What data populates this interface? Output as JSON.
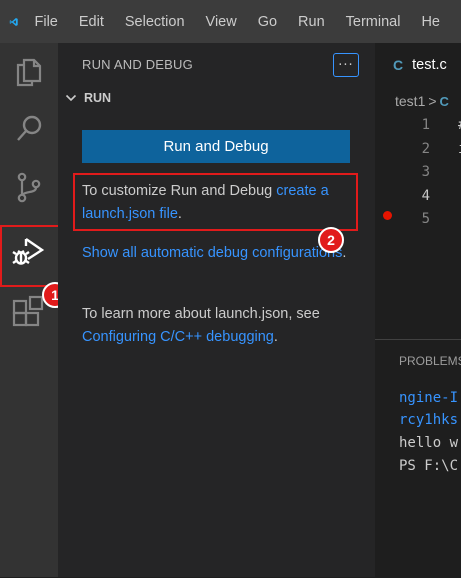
{
  "menubar": {
    "items": [
      "File",
      "Edit",
      "Selection",
      "View",
      "Go",
      "Run",
      "Terminal",
      "He"
    ]
  },
  "activity_bar": {
    "icons": [
      "explorer-icon",
      "search-icon",
      "source-control-icon",
      "run-debug-icon",
      "extensions-icon"
    ]
  },
  "sidebar": {
    "title": "RUN AND DEBUG",
    "more_actions": "···",
    "section": "RUN",
    "run_button_label": "Run and Debug",
    "customize_text": "To customize Run and Debug ",
    "customize_link": "create a launch.json file",
    "customize_end": ".",
    "auto_config_link": "Show all automatic debug configurations",
    "auto_config_end": ".",
    "learn_text": "To learn more about launch.json, see ",
    "learn_link": "Configuring C/C++ debugging",
    "learn_end": "."
  },
  "annotations": {
    "badge1": "1",
    "badge2": "2",
    "color": "#e11b1b"
  },
  "editor": {
    "tab_icon": "C",
    "tab_label": "test.c",
    "breadcrumb_folder": "test1",
    "breadcrumb_sep": ">",
    "breadcrumb_icon": "C",
    "line_numbers": [
      "1",
      "2",
      "3",
      "4",
      "5"
    ],
    "line1_frag": "#",
    "line2_frag": "i"
  },
  "panel": {
    "title": "PROBLEMS",
    "terminal_lines": [
      "ngine-I",
      "rcy1hks",
      "hello w",
      "PS F:\\C"
    ]
  },
  "colors": {
    "accent": "#0e639c",
    "link": "#3794ff",
    "breakpoint": "#e51400"
  }
}
